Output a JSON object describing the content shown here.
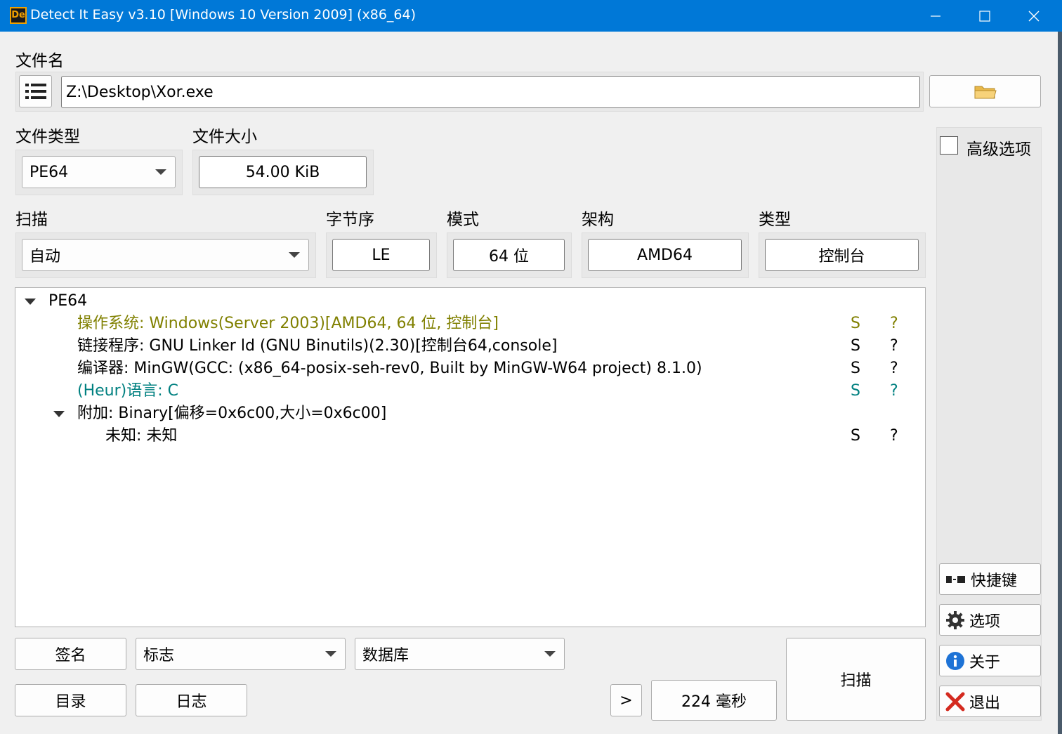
{
  "window": {
    "title": "Detect It Easy v3.10 [Windows 10 Version 2009] (x86_64)",
    "app_icon_text": "De",
    "controls": {
      "minimize": "—",
      "maximize": "☐",
      "close": "✕"
    }
  },
  "file": {
    "label": "文件名",
    "path": "Z:\\Desktop\\Xor.exe"
  },
  "file_type": {
    "label": "文件类型",
    "value": "PE64"
  },
  "file_size": {
    "label": "文件大小",
    "value": "54.00 KiB"
  },
  "scan": {
    "label": "扫描",
    "value": "自动"
  },
  "endianness": {
    "label": "字节序",
    "value": "LE"
  },
  "mode": {
    "label": "模式",
    "value": "64 位"
  },
  "arch": {
    "label": "架构",
    "value": "AMD64"
  },
  "type": {
    "label": "类型",
    "value": "控制台"
  },
  "advanced": {
    "label": "高级选项",
    "checked": false
  },
  "tree": {
    "root": "PE64",
    "rows": [
      {
        "text": "操作系统: Windows(Server 2003)[AMD64, 64 位, 控制台]",
        "s": "S",
        "q": "?",
        "color": "#808000"
      },
      {
        "text": "链接程序: GNU Linker ld (GNU Binutils)(2.30)[控制台64,console]",
        "s": "S",
        "q": "?",
        "color": "#000000"
      },
      {
        "text": "编译器: MinGW(GCC: (x86_64-posix-seh-rev0, Built by MinGW-W64 project) 8.1.0)",
        "s": "S",
        "q": "?",
        "color": "#000000"
      },
      {
        "text": "(Heur)语言: C",
        "s": "S",
        "q": "?",
        "color": "#008080"
      }
    ],
    "overlay": "附加: Binary[偏移=0x6c00,大小=0x6c00]",
    "overlay_child": {
      "text": "未知: 未知",
      "s": "S",
      "q": "?"
    }
  },
  "bottom": {
    "signature": "签名",
    "flags": "标志",
    "database": "数据库",
    "directory": "目录",
    "log": "日志",
    "more": ">",
    "elapsed": "224 毫秒",
    "scan_button": "扫描"
  },
  "side": {
    "shortcuts": "快捷键",
    "options": "选项",
    "about": "关于",
    "exit": "退出"
  },
  "colors": {
    "titlebar": "#0078d7",
    "olive": "#808000",
    "teal": "#008080",
    "exit_red": "#d42a1f",
    "info_blue": "#1e73d6"
  }
}
